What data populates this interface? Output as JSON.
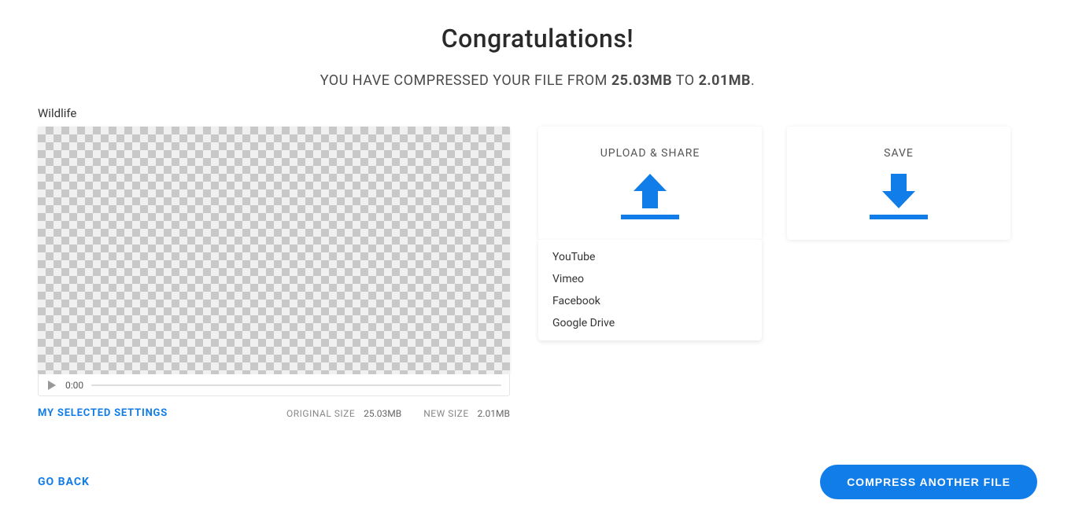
{
  "title": "Congratulations!",
  "subtitle": {
    "prefix": "YOU HAVE COMPRESSED YOUR FILE FROM ",
    "original_size": "25.03MB",
    "mid": " TO ",
    "new_size": "2.01MB",
    "suffix": "."
  },
  "filename": "Wildlife",
  "player": {
    "time": "0:00"
  },
  "meta": {
    "settings_link": "MY SELECTED SETTINGS",
    "original_label": "ORIGINAL SIZE",
    "original_value": "25.03MB",
    "new_label": "NEW SIZE",
    "new_value": "2.01MB"
  },
  "cards": {
    "upload_title": "UPLOAD & SHARE",
    "save_title": "SAVE"
  },
  "share_options": [
    "YouTube",
    "Vimeo",
    "Facebook",
    "Google Drive"
  ],
  "footer": {
    "go_back": "GO BACK",
    "compress_another": "COMPRESS ANOTHER FILE"
  },
  "colors": {
    "accent": "#117de8"
  }
}
